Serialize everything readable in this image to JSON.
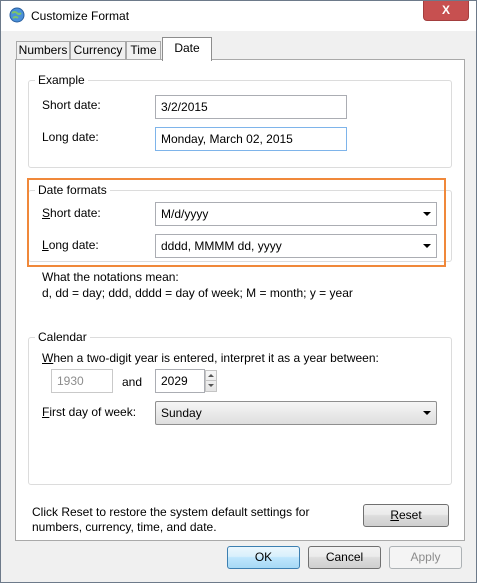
{
  "window": {
    "title": "Customize Format",
    "close_glyph": "X"
  },
  "tabs": [
    {
      "label": "Numbers"
    },
    {
      "label": "Currency"
    },
    {
      "label": "Time"
    },
    {
      "label": "Date"
    }
  ],
  "example": {
    "group_title": "Example",
    "short_label": "Short date:",
    "short_value": "3/2/2015",
    "long_label": "Long date:",
    "long_value": "Monday, March 02, 2015"
  },
  "date_formats": {
    "group_title": "Date formats",
    "short_label_u": "S",
    "short_label_rest": "hort date:",
    "short_value": "M/d/yyyy",
    "long_label_u": "L",
    "long_label_rest": "ong date:",
    "long_value": "dddd, MMMM dd, yyyy",
    "notation_line1": "What the notations mean:",
    "notation_line2": "d, dd = day;  ddd, dddd = day of week;  M = month;  y = year"
  },
  "calendar": {
    "group_title": "Calendar",
    "two_digit_u": "W",
    "two_digit_rest": "hen a two-digit year is entered, interpret it as a year between:",
    "year_from": "1930",
    "and_label": "and",
    "year_to": "2029",
    "first_day_u": "F",
    "first_day_rest": "irst day of week:",
    "first_day_value": "Sunday"
  },
  "footer": {
    "reset_note_line1": "Click Reset to restore the system default settings for",
    "reset_note_line2": "numbers, currency, time, and date.",
    "reset_u": "R",
    "reset_rest": "eset"
  },
  "buttons": {
    "ok": "OK",
    "cancel": "Cancel",
    "apply": "Apply"
  }
}
